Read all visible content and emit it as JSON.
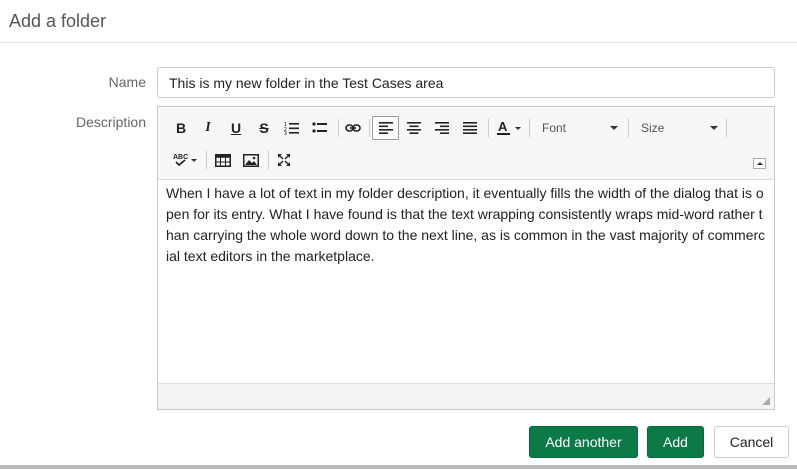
{
  "dialog": {
    "title": "Add a folder"
  },
  "form": {
    "name_label": "Name",
    "name_value": "This is my new folder in the Test Cases area",
    "description_label": "Description"
  },
  "toolbar": {
    "bold": "B",
    "italic": "I",
    "underline": "U",
    "strikethrough": "S",
    "font_label": "Font",
    "size_label": "Size"
  },
  "editor": {
    "content": "When I have a lot of text in my folder description, it eventually fills the width of the dialog that is open for its entry. What I have found is that the text wrapping consistently wraps mid-word rather than carrying the whole  word down to the next line, as is common in the vast majority of commercial text editors in the marketplace."
  },
  "buttons": {
    "add_another": "Add another",
    "add": "Add",
    "cancel": "Cancel"
  },
  "colors": {
    "primary": "#0b7a46"
  }
}
